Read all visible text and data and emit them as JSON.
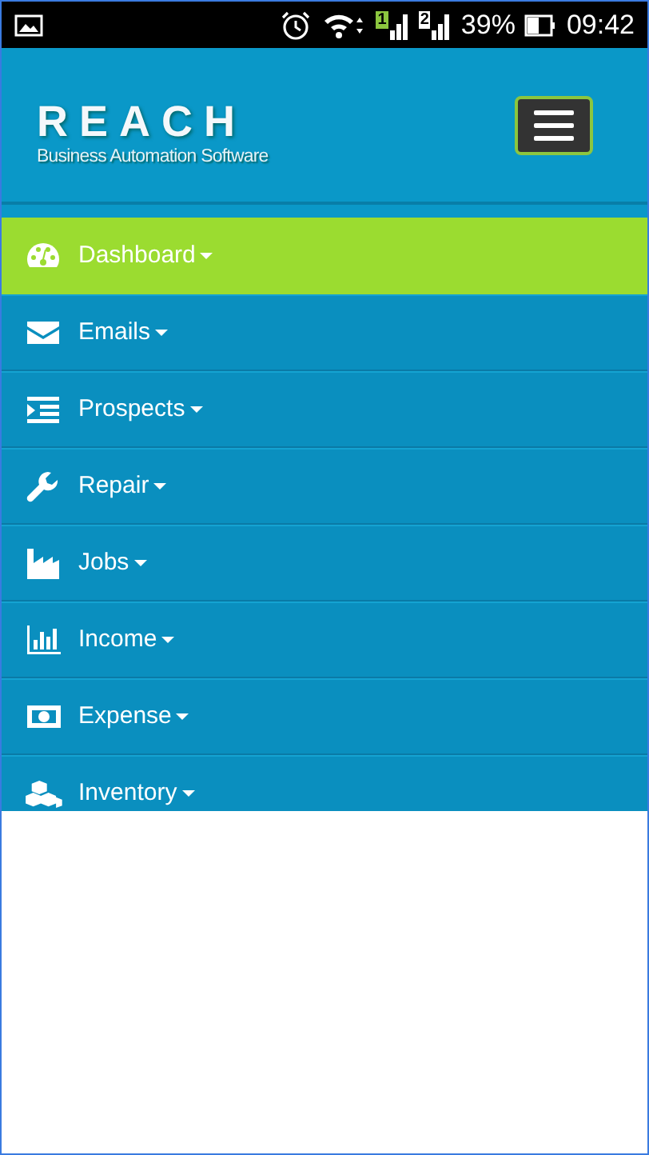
{
  "status_bar": {
    "sims": [
      {
        "label": "1",
        "color": "#8cc63f"
      },
      {
        "label": "2",
        "color": "#ffffff"
      }
    ],
    "battery": "39%",
    "time": "09:42"
  },
  "header": {
    "logo": "REACH",
    "tagline": "Business Automation Software"
  },
  "menu": [
    {
      "label": "Dashboard",
      "kind": "gauge",
      "selected": true
    },
    {
      "label": "Emails",
      "kind": "envelope",
      "selected": false
    },
    {
      "label": "Prospects",
      "kind": "indent",
      "selected": false
    },
    {
      "label": "Repair",
      "kind": "wrench",
      "selected": false
    },
    {
      "label": "Jobs",
      "kind": "factory",
      "selected": false
    },
    {
      "label": "Income",
      "kind": "barchart",
      "selected": false
    },
    {
      "label": "Expense",
      "kind": "money",
      "selected": false
    },
    {
      "label": "Inventory",
      "kind": "cubes",
      "selected": false
    }
  ]
}
